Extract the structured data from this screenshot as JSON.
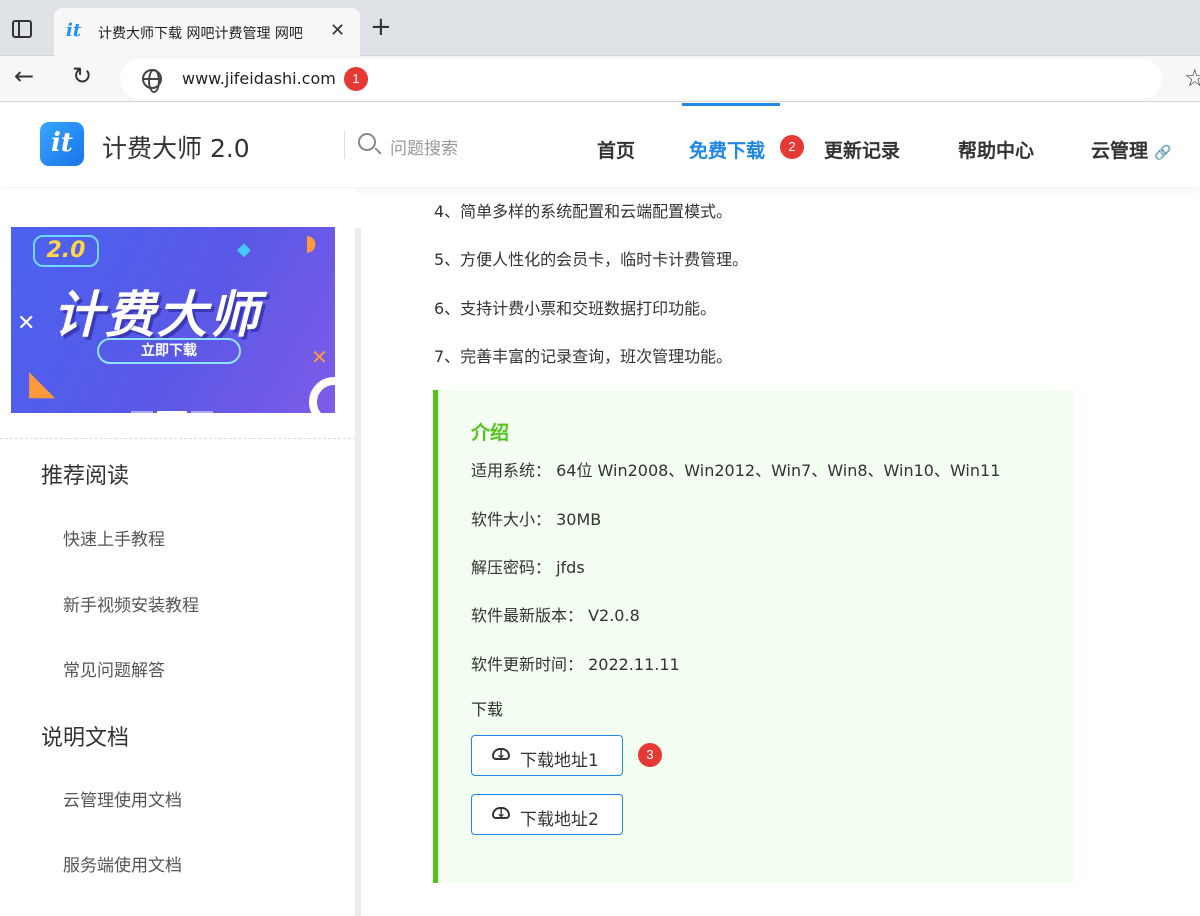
{
  "browser": {
    "tab_title": "计费大师下载 网吧计费管理 网吧",
    "tab_logo": "it",
    "close_glyph": "✕",
    "new_tab_glyph": "+",
    "back_glyph": "←",
    "reload_glyph": "↻",
    "star_glyph": "☆",
    "url": "www.jifeidashi.com",
    "badge_1": "1"
  },
  "header": {
    "logo": "it",
    "site_name": "计费大师 2.0",
    "search_placeholder": "问题搜索",
    "nav": {
      "home": "首页",
      "download": "免费下载",
      "changelog": "更新记录",
      "help": "帮助中心",
      "cloud": "云管理"
    },
    "badge_2": "2",
    "link_glyph": "🔗"
  },
  "sidebar": {
    "banner": {
      "badge": "2.0",
      "title": "计费大师",
      "button": "立即下载"
    },
    "recommended_heading": "推荐阅读",
    "recommended": [
      "快速上手教程",
      "新手视频安装教程",
      "常见问题解答"
    ],
    "docs_heading": "说明文档",
    "docs": [
      "云管理使用文档",
      "服务端使用文档"
    ]
  },
  "content": {
    "features": [
      "4、简单多样的系统配置和云端配置模式。",
      "5、方便人性化的会员卡，临时卡计费管理。",
      "6、支持计费小票和交班数据打印功能。",
      "7、完善丰富的记录查询，班次管理功能。"
    ],
    "info": {
      "title": "介绍",
      "system": "适用系统： 64位 Win2008、Win2012、Win7、Win8、Win10、Win11",
      "size": "软件大小： 30MB",
      "password": "解压密码： jfds",
      "version": "软件最新版本： V2.0.8",
      "updated": "软件更新时间： 2022.11.11",
      "download_label": "下载",
      "download_1": "下载地址1",
      "download_2": "下载地址2",
      "badge_3": "3"
    }
  },
  "colors": {
    "accent": "#1e88e5",
    "green": "#52c41a",
    "badge": "#e53935"
  }
}
